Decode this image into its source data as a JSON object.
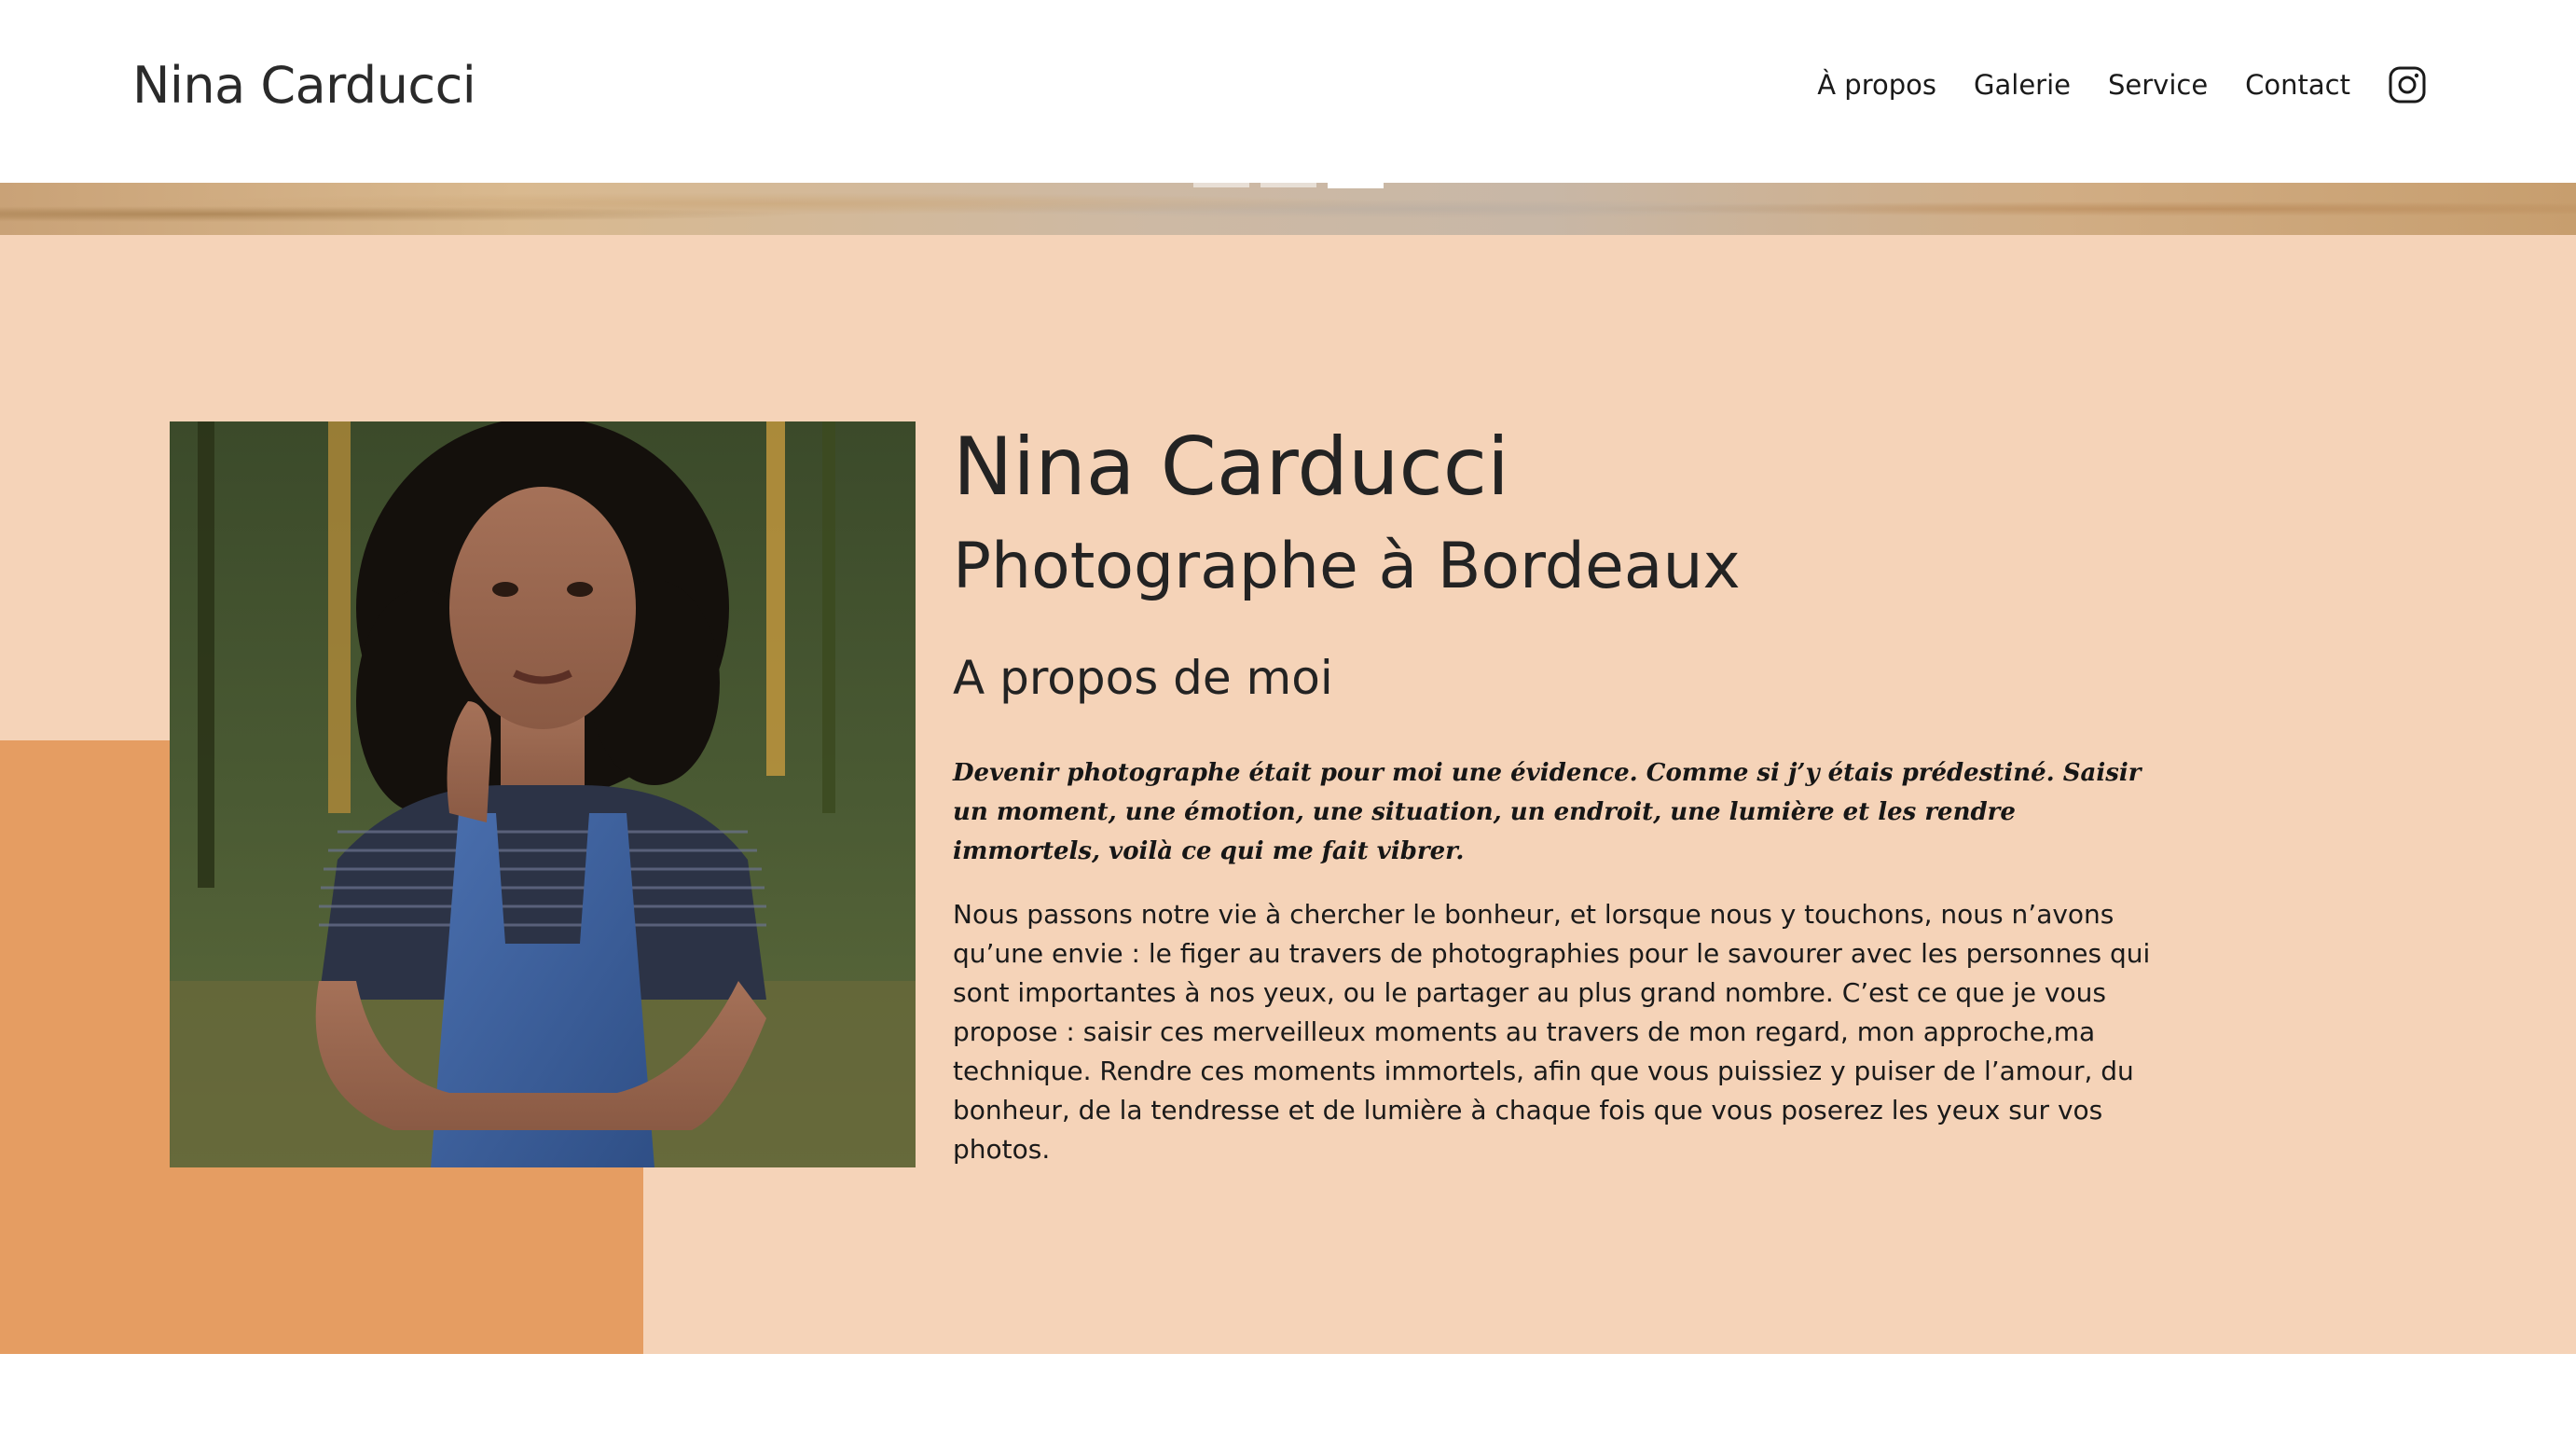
{
  "header": {
    "brand": "Nina Carducci",
    "nav": [
      {
        "label": "À propos"
      },
      {
        "label": "Galerie"
      },
      {
        "label": "Service"
      },
      {
        "label": "Contact"
      }
    ],
    "instagram_icon": "instagram-icon"
  },
  "carousel": {
    "indicator_count": 3,
    "active_index": 2
  },
  "about": {
    "name": "Nina Carducci",
    "subtitle": "Photographe à Bordeaux",
    "section_title": "A propos de moi",
    "quote": "Devenir photographe était pour moi une évidence. Comme si j’y étais prédestiné. Saisir un moment, une émotion, une situation, un endroit, une lumière et les rendre immortels, voilà ce qui me fait vibrer.",
    "body": "Nous passons notre vie à chercher le bonheur, et lorsque nous y touchons, nous n’avons qu’une envie : le figer au travers de photographies pour le savourer avec les personnes qui sont importantes à nos yeux, ou le partager au plus grand nombre. C’est ce que je vous propose : saisir ces merveilleux moments au travers de mon regard, mon approche,ma technique. Rendre ces moments immortels, afin que vous puissiez y puiser de l’amour, du bonheur, de la tendresse et de lumière à chaque fois que vous poserez les yeux sur vos photos."
  },
  "colors": {
    "section_bg": "#f5d3b8",
    "accent_block": "#e59d62",
    "text": "#232323"
  }
}
